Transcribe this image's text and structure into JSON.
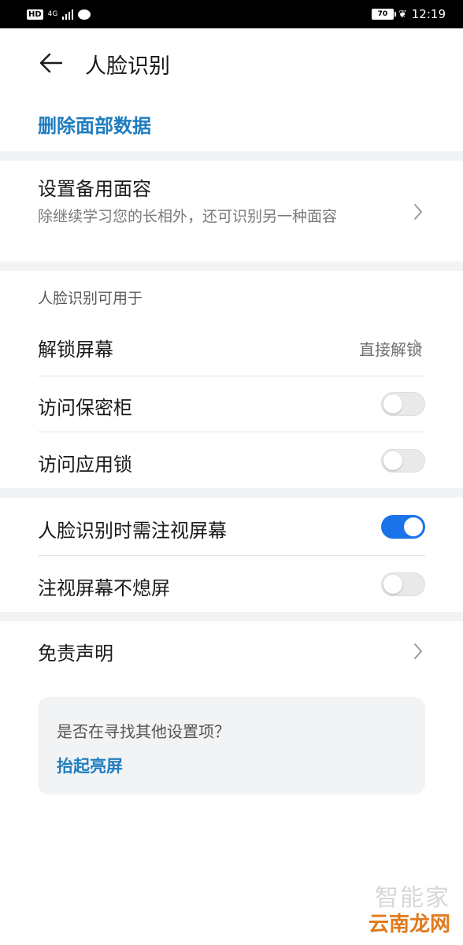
{
  "status_bar": {
    "hd": "HD",
    "network": "4G",
    "battery": "70",
    "time": "12:19"
  },
  "header": {
    "title": "人脸识别"
  },
  "delete": {
    "label": "删除面部数据"
  },
  "backup_face": {
    "title": "设置备用面容",
    "subtitle": "除继续学习您的长相外，还可识别另一种面容"
  },
  "usage": {
    "section_label": "人脸识别可用于",
    "unlock": {
      "title": "解锁屏幕",
      "value": "直接解锁"
    },
    "vault": {
      "title": "访问保密柜",
      "enabled": false
    },
    "app_lock": {
      "title": "访问应用锁",
      "enabled": false
    }
  },
  "attention": {
    "require_gaze": {
      "title": "人脸识别时需注视屏幕",
      "enabled": true
    },
    "keep_on": {
      "title": "注视屏幕不熄屏",
      "enabled": false
    }
  },
  "disclaimer": {
    "title": "免责声明"
  },
  "suggestion": {
    "question": "是否在寻找其他设置项？",
    "link": "抬起亮屏"
  },
  "watermark": {
    "top": "智能家",
    "bottom": "云南龙网"
  },
  "colors": {
    "accent": "#1f7dbe",
    "toggle_on": "#1a73e8",
    "section_gap": "#f1f3f5"
  }
}
